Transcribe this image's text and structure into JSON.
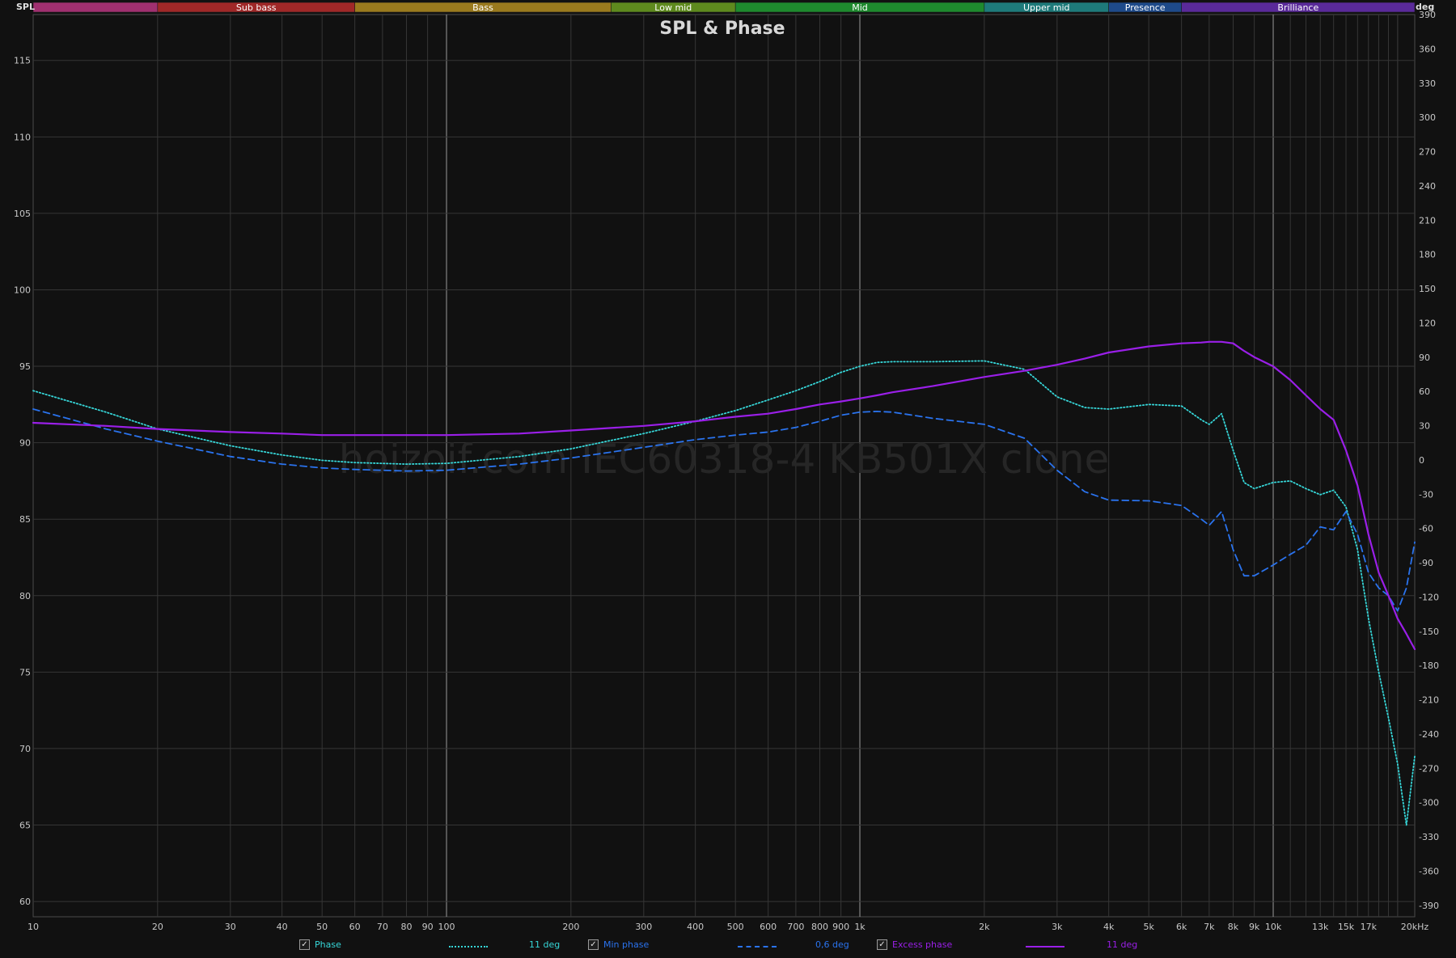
{
  "chart_data": {
    "type": "line",
    "title": "SPL & Phase",
    "watermark": "hoizoif.com IEC60318-4 KB501X clone",
    "ylabel_left": "SPL",
    "ylabel_right": "deg",
    "x_unit_label": "20kHz",
    "xscale": "log",
    "xlim": [
      10,
      22000
    ],
    "ylim_left": [
      59,
      118
    ],
    "ylim_right": [
      -400,
      390
    ],
    "grid": true,
    "bands": [
      {
        "label": "",
        "from": 10,
        "to": 20,
        "color": "#a03070"
      },
      {
        "label": "Sub bass",
        "from": 20,
        "to": 60,
        "color": "#a02828"
      },
      {
        "label": "Bass",
        "from": 60,
        "to": 250,
        "color": "#9a7a1e"
      },
      {
        "label": "Low mid",
        "from": 250,
        "to": 500,
        "color": "#5e8a1e"
      },
      {
        "label": "Mid",
        "from": 500,
        "to": 2000,
        "color": "#1e8a2e"
      },
      {
        "label": "Upper mid",
        "from": 2000,
        "to": 4000,
        "color": "#1e7a7a"
      },
      {
        "label": "Presence",
        "from": 4000,
        "to": 6000,
        "color": "#1e4a8a"
      },
      {
        "label": "Brilliance",
        "from": 6000,
        "to": 22000,
        "color": "#5a2a9a"
      }
    ],
    "x_ticks": [
      {
        "v": 10,
        "label": "10"
      },
      {
        "v": 20,
        "label": "20"
      },
      {
        "v": 30,
        "label": "30"
      },
      {
        "v": 40,
        "label": "40"
      },
      {
        "v": 50,
        "label": "50"
      },
      {
        "v": 60,
        "label": "60"
      },
      {
        "v": 70,
        "label": "70"
      },
      {
        "v": 80,
        "label": "80"
      },
      {
        "v": 90,
        "label": "90"
      },
      {
        "v": 100,
        "label": "100"
      },
      {
        "v": 200,
        "label": "200"
      },
      {
        "v": 300,
        "label": "300"
      },
      {
        "v": 400,
        "label": "400"
      },
      {
        "v": 500,
        "label": "500"
      },
      {
        "v": 600,
        "label": "600"
      },
      {
        "v": 700,
        "label": "700"
      },
      {
        "v": 800,
        "label": "800"
      },
      {
        "v": 900,
        "label": "900"
      },
      {
        "v": 1000,
        "label": "1k"
      },
      {
        "v": 2000,
        "label": "2k"
      },
      {
        "v": 3000,
        "label": "3k"
      },
      {
        "v": 4000,
        "label": "4k"
      },
      {
        "v": 5000,
        "label": "5k"
      },
      {
        "v": 6000,
        "label": "6k"
      },
      {
        "v": 7000,
        "label": "7k"
      },
      {
        "v": 8000,
        "label": "8k"
      },
      {
        "v": 9000,
        "label": "9k"
      },
      {
        "v": 10000,
        "label": "10k"
      },
      {
        "v": 13000,
        "label": "13k"
      },
      {
        "v": 15000,
        "label": "15k"
      },
      {
        "v": 17000,
        "label": "17k"
      }
    ],
    "y_ticks_left": [
      60,
      65,
      70,
      75,
      80,
      85,
      90,
      95,
      100,
      105,
      110,
      115
    ],
    "y_ticks_right": [
      390,
      360,
      330,
      300,
      270,
      240,
      210,
      180,
      150,
      120,
      90,
      60,
      30,
      0,
      -30,
      -60,
      -90,
      -120,
      -150,
      -180,
      -210,
      -240,
      -270,
      -300,
      -330,
      -360,
      -390
    ],
    "series": [
      {
        "name": "Phase",
        "axis": "left",
        "color": "#36d6d8",
        "style": "dotted",
        "legend_value": "11 deg",
        "x": [
          10,
          15,
          20,
          30,
          40,
          50,
          60,
          80,
          100,
          150,
          200,
          300,
          400,
          500,
          600,
          700,
          800,
          900,
          1000,
          1100,
          1200,
          1500,
          2000,
          2500,
          3000,
          3500,
          4000,
          5000,
          6000,
          6700,
          7000,
          7500,
          8000,
          8500,
          9000,
          10000,
          11000,
          12000,
          13000,
          14000,
          15000,
          16000,
          17000,
          18000,
          19000,
          20000,
          21000,
          22000
        ],
        "y": [
          93.4,
          92.0,
          90.9,
          89.8,
          89.2,
          88.85,
          88.7,
          88.6,
          88.65,
          89.1,
          89.6,
          90.6,
          91.4,
          92.1,
          92.8,
          93.4,
          94.0,
          94.6,
          95.0,
          95.25,
          95.3,
          95.3,
          95.35,
          94.8,
          93.0,
          92.3,
          92.2,
          92.5,
          92.4,
          91.5,
          91.2,
          91.9,
          89.5,
          87.4,
          87.0,
          87.4,
          87.5,
          87.0,
          86.6,
          86.9,
          85.8,
          83.0,
          78.5,
          75.0,
          72.0,
          69.0,
          65.0,
          69.5
        ]
      },
      {
        "name": "Min phase",
        "axis": "left",
        "color": "#2a73ee",
        "style": "dashed",
        "legend_value": "0,6 deg",
        "x": [
          10,
          15,
          20,
          30,
          40,
          50,
          60,
          80,
          100,
          150,
          200,
          300,
          400,
          500,
          600,
          700,
          800,
          900,
          1000,
          1100,
          1200,
          1500,
          2000,
          2500,
          3000,
          3500,
          4000,
          5000,
          6000,
          6700,
          7000,
          7500,
          8000,
          8500,
          9000,
          10000,
          11000,
          12000,
          13000,
          14000,
          15000,
          16000,
          17000,
          18000,
          19000,
          20000,
          21000,
          22000
        ],
        "y": [
          92.2,
          90.9,
          90.1,
          89.1,
          88.6,
          88.35,
          88.25,
          88.15,
          88.2,
          88.6,
          89.0,
          89.7,
          90.2,
          90.5,
          90.7,
          91.0,
          91.4,
          91.8,
          92.0,
          92.05,
          92.0,
          91.6,
          91.2,
          90.3,
          88.2,
          86.8,
          86.25,
          86.2,
          85.9,
          85.0,
          84.6,
          85.5,
          83.0,
          81.3,
          81.3,
          82.0,
          82.7,
          83.3,
          84.5,
          84.3,
          85.5,
          84.0,
          81.5,
          80.5,
          80.0,
          79.0,
          80.5,
          83.5
        ]
      },
      {
        "name": "Excess phase",
        "axis": "left",
        "color": "#9a1fe8",
        "style": "solid",
        "legend_value": "11 deg",
        "x": [
          10,
          15,
          20,
          30,
          40,
          50,
          60,
          80,
          100,
          150,
          200,
          300,
          400,
          500,
          600,
          700,
          800,
          900,
          1000,
          1100,
          1200,
          1500,
          2000,
          2500,
          3000,
          3500,
          4000,
          5000,
          6000,
          6700,
          7000,
          7500,
          8000,
          8500,
          9000,
          10000,
          11000,
          12000,
          13000,
          14000,
          15000,
          16000,
          17000,
          18000,
          19000,
          20000,
          21000,
          22000
        ],
        "y": [
          91.3,
          91.1,
          90.9,
          90.7,
          90.6,
          90.5,
          90.5,
          90.5,
          90.5,
          90.6,
          90.8,
          91.1,
          91.4,
          91.7,
          91.9,
          92.2,
          92.5,
          92.7,
          92.9,
          93.1,
          93.3,
          93.7,
          94.3,
          94.7,
          95.1,
          95.5,
          95.9,
          96.3,
          96.5,
          96.55,
          96.6,
          96.6,
          96.5,
          96.0,
          95.6,
          95.0,
          94.1,
          93.1,
          92.2,
          91.5,
          89.5,
          87.2,
          84.0,
          81.5,
          80.0,
          78.5,
          77.5,
          76.5
        ]
      }
    ],
    "legend": [
      {
        "label": "Phase",
        "checked": true
      },
      {
        "label": "Min phase",
        "checked": true
      },
      {
        "label": "Excess phase",
        "checked": true
      }
    ]
  }
}
